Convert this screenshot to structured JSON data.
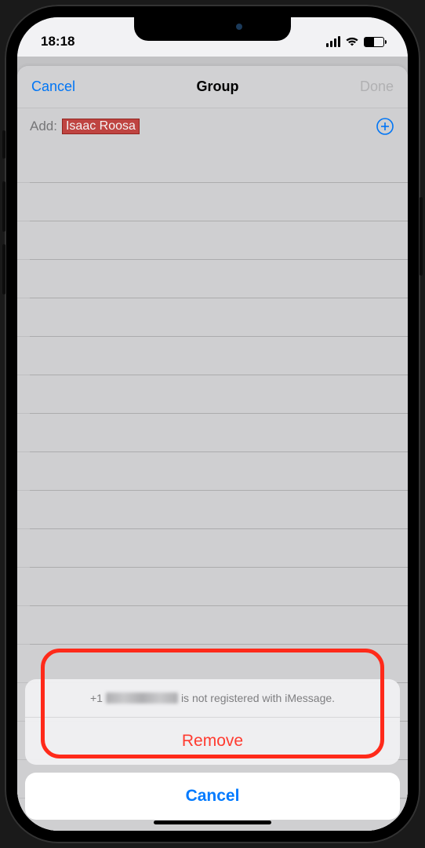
{
  "status": {
    "time": "18:18"
  },
  "nav": {
    "cancel": "Cancel",
    "title": "Group",
    "done": "Done"
  },
  "add": {
    "label": "Add:",
    "contact_token": "Isaac Roosa"
  },
  "sheet": {
    "phone_prefix": "+1",
    "message_suffix": "is not registered with iMessage.",
    "remove": "Remove",
    "cancel": "Cancel"
  }
}
